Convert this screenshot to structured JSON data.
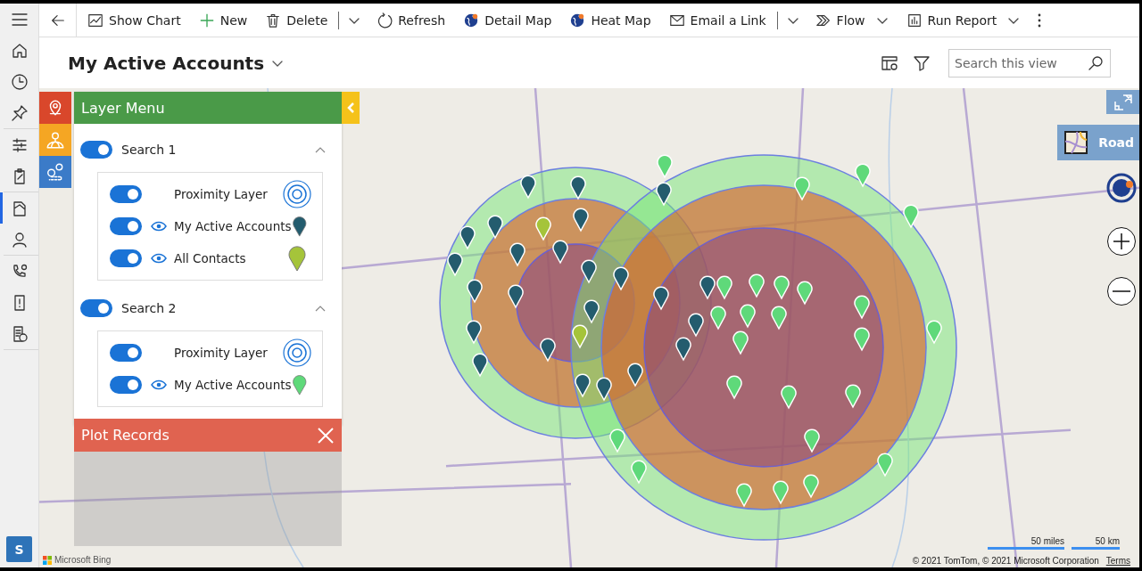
{
  "nav_rail": {
    "items": [
      {
        "kind": "menu",
        "selected": false
      },
      {
        "kind": "home",
        "selected": false
      },
      {
        "kind": "recent",
        "selected": false
      },
      {
        "kind": "pinned",
        "selected": false
      },
      {
        "kind": "sliders",
        "selected": false
      },
      {
        "kind": "clipboard",
        "selected": false
      },
      {
        "kind": "map",
        "selected": true
      },
      {
        "kind": "person",
        "selected": false
      },
      {
        "kind": "phone",
        "selected": false
      },
      {
        "kind": "alert",
        "selected": false
      },
      {
        "kind": "report",
        "selected": false
      }
    ],
    "user": {
      "initial": "S"
    }
  },
  "command_bar": {
    "items": [
      {
        "kind": "back",
        "caret": false
      },
      {
        "kind": "chart",
        "label": "Show Chart",
        "caret": false
      },
      {
        "kind": "new",
        "label": "New",
        "caret": false
      },
      {
        "kind": "delete",
        "label": "Delete",
        "caret": false
      },
      {
        "kind": "dropdown"
      },
      {
        "kind": "refresh",
        "label": "Refresh",
        "caret": false
      },
      {
        "kind": "globe",
        "label": "Detail Map",
        "caret": false
      },
      {
        "kind": "globe",
        "label": "Heat Map",
        "caret": false
      },
      {
        "kind": "email",
        "label": "Email a Link",
        "caret": false
      },
      {
        "kind": "dropdown"
      },
      {
        "kind": "flow",
        "label": "Flow",
        "caret": true
      },
      {
        "kind": "report",
        "label": "Run Report",
        "caret": true
      },
      {
        "kind": "more",
        "caret": false
      }
    ]
  },
  "view": {
    "title": "My Active Accounts",
    "search": {
      "placeholder": "Search this view"
    }
  },
  "side_tabs": [
    {
      "kind": "pin",
      "color": "#d9472b"
    },
    {
      "kind": "globe",
      "color": "#f5a623"
    },
    {
      "kind": "route",
      "color": "#3b7bc8"
    }
  ],
  "layer_menu": {
    "title": "Layer Menu",
    "searches": [
      {
        "name": "Search 1",
        "on": true,
        "expanded": true,
        "layers": [
          {
            "kind": "proximity",
            "label": "Proximity Layer",
            "on": true
          },
          {
            "kind": "pins",
            "label": "My Active Accounts",
            "on": true,
            "color": "#245c6e"
          },
          {
            "kind": "pins",
            "label": "All Contacts",
            "on": true,
            "color": "#a5c43a"
          }
        ]
      },
      {
        "name": "Search 2",
        "on": true,
        "expanded": true,
        "layers": [
          {
            "kind": "proximity",
            "label": "Proximity Layer",
            "on": true
          },
          {
            "kind": "pins",
            "label": "My Active Accounts",
            "on": true,
            "color": "#5fd97a"
          }
        ]
      }
    ]
  },
  "plot_records": {
    "title": "Plot Records"
  },
  "map": {
    "style_button": "Road",
    "scale": [
      "50 miles",
      "50 km"
    ],
    "logo": "Microsoft Bing",
    "attribution": "© 2021 TomTom, © 2021 Microsoft Corporation",
    "terms": "Terms"
  }
}
